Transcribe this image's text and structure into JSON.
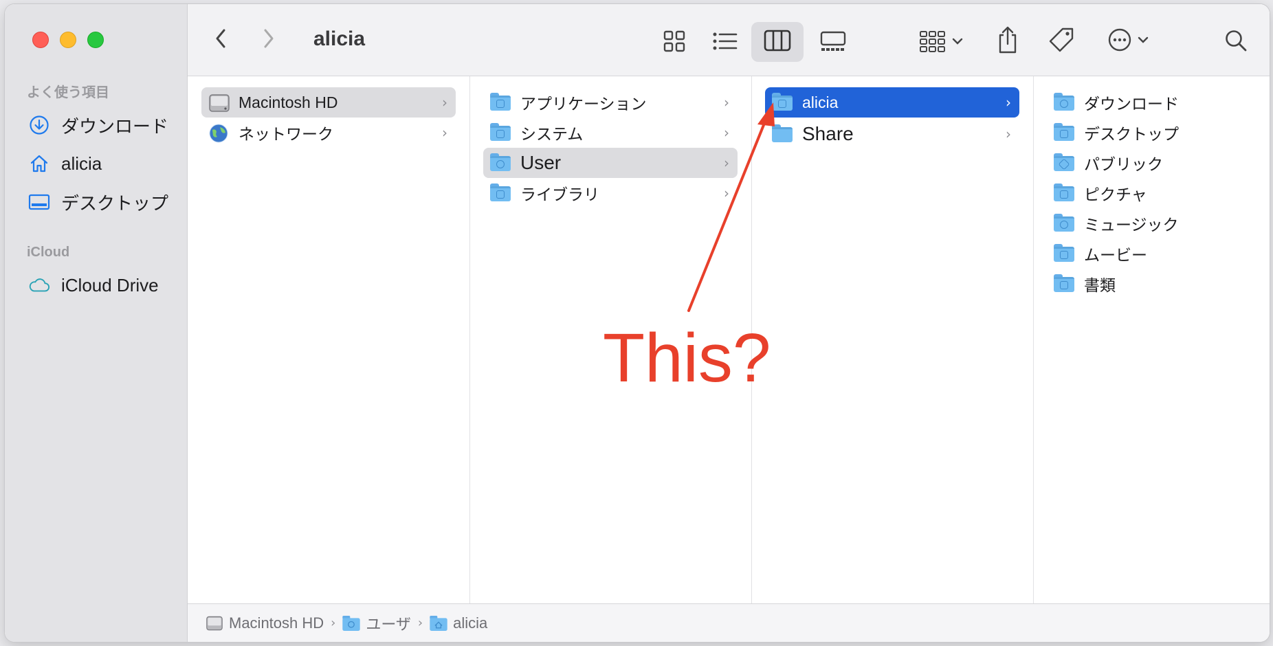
{
  "window": {
    "title": "alicia"
  },
  "sidebar": {
    "sections": [
      {
        "title": "よく使う項目",
        "items": [
          {
            "label": "ダウンロード",
            "icon": "download-icon"
          },
          {
            "label": "alicia",
            "icon": "home-icon"
          },
          {
            "label": "デスクトップ",
            "icon": "desktop-icon"
          }
        ]
      },
      {
        "title": "iCloud",
        "items": [
          {
            "label": "iCloud Drive",
            "icon": "cloud-icon"
          }
        ]
      }
    ]
  },
  "toolbar": {
    "back": "back-icon",
    "forward": "forward-icon",
    "views": [
      "icon-view",
      "list-view",
      "column-view",
      "gallery-view"
    ],
    "selected_view": "column-view"
  },
  "columns": [
    {
      "items": [
        {
          "label": "Macintosh HD",
          "icon": "hard-drive-icon",
          "selected": "gray"
        },
        {
          "label": "ネットワーク",
          "icon": "network-globe-icon"
        }
      ]
    },
    {
      "items": [
        {
          "label": "アプリケーション",
          "icon": "applications-folder-icon"
        },
        {
          "label": "システム",
          "icon": "system-folder-icon"
        },
        {
          "label": "User",
          "icon": "users-folder-icon",
          "selected": "gray"
        },
        {
          "label": "ライブラリ",
          "icon": "library-folder-icon"
        }
      ]
    },
    {
      "items": [
        {
          "label": "alicia",
          "icon": "home-folder-icon",
          "selected": "blue"
        },
        {
          "label": "Share",
          "icon": "folder-icon"
        }
      ]
    },
    {
      "items": [
        {
          "label": "ダウンロード",
          "icon": "downloads-folder-icon"
        },
        {
          "label": "デスクトップ",
          "icon": "desktop-folder-icon"
        },
        {
          "label": "パブリック",
          "icon": "public-folder-icon"
        },
        {
          "label": "ピクチャ",
          "icon": "pictures-folder-icon"
        },
        {
          "label": "ミュージック",
          "icon": "music-folder-icon"
        },
        {
          "label": "ムービー",
          "icon": "movies-folder-icon"
        },
        {
          "label": "書類",
          "icon": "documents-folder-icon"
        }
      ]
    }
  ],
  "pathbar": [
    {
      "label": "Macintosh HD",
      "icon": "hard-drive-icon"
    },
    {
      "label": "ユーザ",
      "icon": "users-folder-icon"
    },
    {
      "label": "alicia",
      "icon": "home-folder-icon"
    }
  ],
  "annotation": {
    "text": "This?",
    "color": "#e8402b"
  },
  "colors": {
    "selection_blue": "#2163d8",
    "selection_gray": "#dcdcdf",
    "folder_blue": "#72bdf2"
  }
}
